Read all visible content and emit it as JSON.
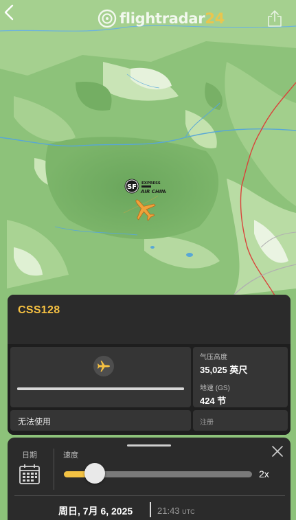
{
  "header": {
    "logo_text": "flightradar",
    "logo_number": "24",
    "back_icon": "chevron-left-icon",
    "share_icon": "share-icon"
  },
  "map": {
    "airline_logo_text": "SF EXPRESS AIR CHINA",
    "aircraft_icon": "aircraft-icon",
    "aircraft_color": "#f0a23a"
  },
  "flight_card": {
    "callsign": "CSS128",
    "status": "无法使用",
    "altitude_label": "气压高度",
    "altitude_value": "35,025 英尺",
    "speed_label": "地速 (GS)",
    "speed_value": "424 节",
    "registration_label": "注册",
    "progress": 1.0,
    "accent_color": "#f6c142"
  },
  "playback": {
    "date_label": "日期",
    "speed_label": "速度",
    "speed_value": "2x",
    "speed_slider_level": 0.17,
    "date_value": "周日, 7月 6, 2025",
    "time_value": "21:43",
    "time_zone": "UTC",
    "calendar_icon": "calendar-icon",
    "close_icon": "close-icon"
  }
}
